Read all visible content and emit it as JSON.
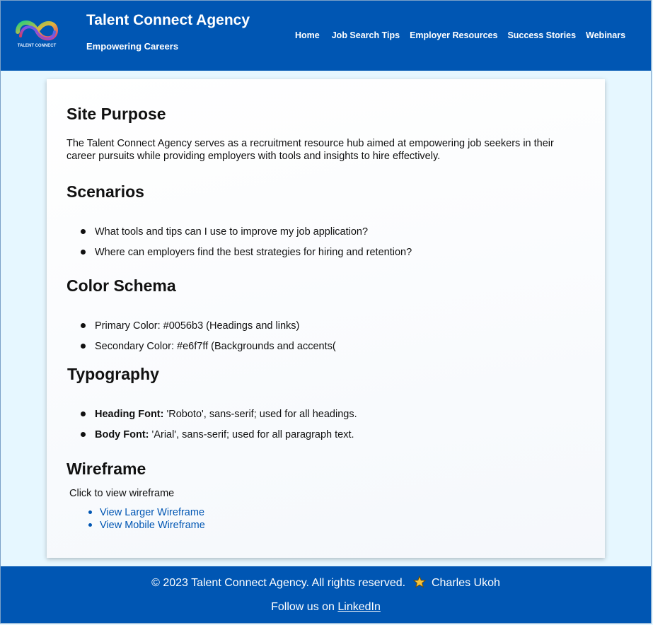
{
  "brand": {
    "logo_text": "TALENT CONNECT",
    "title": "Talent Connect Agency",
    "tagline": "Empowering Careers"
  },
  "nav": [
    "Home",
    "Job Search Tips",
    "Employer Resources",
    "Success Stories",
    "Webinars"
  ],
  "purpose": {
    "heading": "Site Purpose",
    "text": "The Talent Connect Agency serves as a recruitment resource hub aimed at empowering job seekers in their career pursuits while providing employers with tools and insights to hire effectively."
  },
  "scenarios": {
    "heading": "Scenarios",
    "items": [
      "What tools and tips can I use to improve my job application?",
      "Where can employers find the best strategies for hiring and retention?"
    ]
  },
  "colors": {
    "heading": "Color Schema",
    "items": [
      "Primary Color: #0056b3 (Headings and links)",
      "Secondary Color: #e6f7ff (Backgrounds and accents("
    ],
    "primary": "#0056b3",
    "secondary": "#e6f7ff"
  },
  "typography": {
    "heading": "Typography",
    "items": [
      {
        "label": "Heading Font:",
        "text": " 'Roboto', sans-serif; used for all headings."
      },
      {
        "label": "Body Font:",
        "text": " 'Arial', sans-serif; used for all paragraph text."
      }
    ]
  },
  "wireframe": {
    "heading": "Wireframe",
    "caption": "Click to view wireframe",
    "links": [
      "View Larger Wireframe",
      "View Mobile Wireframe"
    ]
  },
  "footer": {
    "copyright": "© 2023 Talent Connect Agency. All rights reserved.",
    "author": "Charles Ukoh",
    "follow_text": "Follow us on",
    "linkedin": "LinkedIn",
    "star_icon": "star-icon"
  }
}
